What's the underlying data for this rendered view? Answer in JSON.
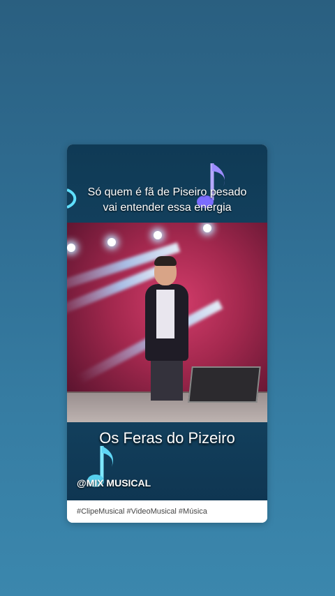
{
  "post": {
    "caption_line1": "Só quem é fã de Piseiro pesado",
    "caption_line2": "vai entender essa energia",
    "band_title": "Os Feras do Pizeiro",
    "watermark": "@MIX MUSICAL",
    "hashtags": "#ClipeMusical #VideoMusical #Música"
  },
  "icons": {
    "top_note": "music-note-icon",
    "bottom_note": "music-note-icon"
  },
  "colors": {
    "background": "#2f6d92",
    "band": "#123f5c",
    "note_cyan": "#69e6ff",
    "note_purple": "#8a7bff",
    "stage_red": "#c63662"
  }
}
